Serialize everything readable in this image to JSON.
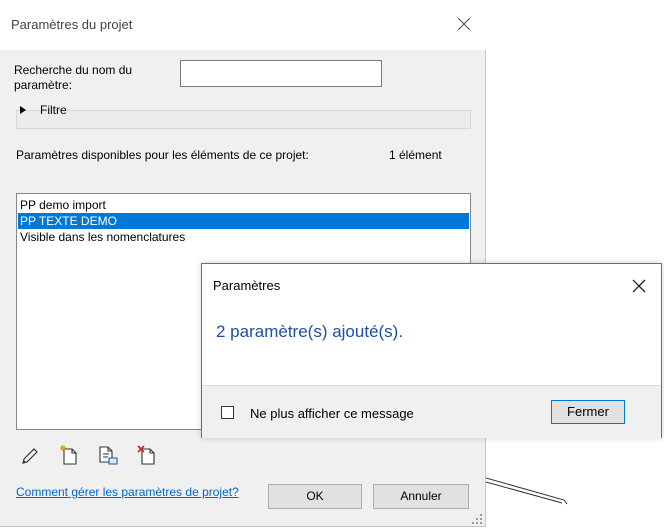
{
  "main_dialog": {
    "title": "Paramètres du projet",
    "search_label_line1": "Recherche du nom du",
    "search_label_line2": "paramètre:",
    "search_value": "",
    "filter_label": "Filtre",
    "available_label": "Paramètres disponibles pour les éléments de ce projet:",
    "count_label": "1 élément",
    "parameters": [
      {
        "label": "PP demo import",
        "selected": false
      },
      {
        "label": "PP TEXTE DEMO",
        "selected": true
      },
      {
        "label": "Visible dans les nomenclatures",
        "selected": false
      }
    ],
    "toolbar_icons": [
      "edit-pencil-icon",
      "new-parameter-icon",
      "export-parameter-icon",
      "delete-parameter-icon"
    ],
    "help_link": "Comment gérer les paramètres de projet?",
    "ok_label": "OK",
    "cancel_label": "Annuler"
  },
  "message_dialog": {
    "title": "Paramètres",
    "message": "2 paramètre(s) ajouté(s).",
    "checkbox_label": "Ne plus afficher ce message",
    "checkbox_checked": false,
    "close_label": "Fermer"
  },
  "colors": {
    "selection": "#0078d7",
    "message_text": "#1e4fa3",
    "link": "#0066cc",
    "dialog_bg": "#f0f0f0"
  }
}
